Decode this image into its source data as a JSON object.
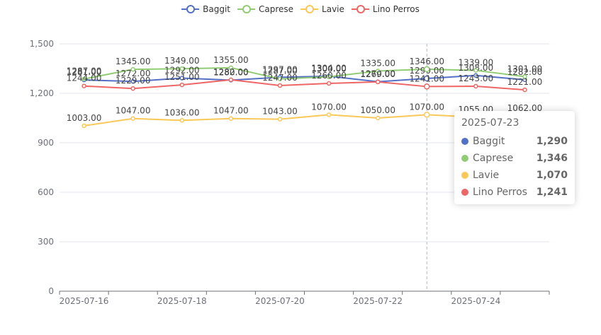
{
  "chart_data": {
    "type": "line",
    "categories": [
      "2025-07-16",
      "2025-07-17",
      "2025-07-18",
      "2025-07-19",
      "2025-07-20",
      "2025-07-21",
      "2025-07-22",
      "2025-07-23",
      "2025-07-24",
      "2025-07-25"
    ],
    "x_tick_labels": [
      "2025-07-16",
      "2025-07-18",
      "2025-07-20",
      "2025-07-22",
      "2025-07-24"
    ],
    "ylim": [
      0,
      1500
    ],
    "y_ticks": [
      0,
      300,
      600,
      900,
      1200,
      1500
    ],
    "y_tick_labels": [
      "0",
      "300",
      "600",
      "900",
      "1,200",
      "1,500"
    ],
    "grid": true,
    "legend_position": "top-center",
    "series": [
      {
        "name": "Baggit",
        "color": "#5470c6",
        "values": [
          1281,
          1272,
          1292,
          1280,
          1297,
          1304,
          1270,
          1290,
          1308,
          1282
        ],
        "labels": [
          "1281.00",
          "1272.00",
          "1292.00",
          "1280.00",
          "1297.00",
          "1304.00",
          "1270.00",
          "1290.00",
          "1308.00",
          "1282.00"
        ]
      },
      {
        "name": "Caprese",
        "color": "#91cc75",
        "values": [
          1287,
          1345,
          1349,
          1355,
          1287,
          1300,
          1335,
          1346,
          1339,
          1301
        ],
        "labels": [
          "1287.00",
          "1345.00",
          "1349.00",
          "1355.00",
          "1287.00",
          "1300.00",
          "1335.00",
          "1346.00",
          "1339.00",
          "1301.00"
        ]
      },
      {
        "name": "Lavie",
        "color": "#fac858",
        "values": [
          1003,
          1047,
          1036,
          1047,
          1043,
          1070,
          1050,
          1070,
          1055,
          1062
        ],
        "labels": [
          "1003.00",
          "1047.00",
          "1036.00",
          "1047.00",
          "1043.00",
          "1070.00",
          "1050.00",
          "1070.00",
          "1055.00",
          "1062.00"
        ]
      },
      {
        "name": "Lino Perros",
        "color": "#ee6666",
        "values": [
          1244,
          1229,
          1251,
          1282,
          1247,
          1260,
          1269,
          1241,
          1243,
          1221
        ],
        "labels": [
          "1244.00",
          "1229.00",
          "1251.00",
          "1282.00",
          "1247.00",
          "1260.00",
          "1269.00",
          "1241.00",
          "1243.00",
          "1221.00"
        ]
      }
    ],
    "tooltip": {
      "category_index": 7,
      "title": "2025-07-23",
      "rows": [
        {
          "name": "Baggit",
          "value": "1,290",
          "color": "#5470c6"
        },
        {
          "name": "Caprese",
          "value": "1,346",
          "color": "#91cc75"
        },
        {
          "name": "Lavie",
          "value": "1,070",
          "color": "#fac858"
        },
        {
          "name": "Lino Perros",
          "value": "1,241",
          "color": "#ee6666"
        }
      ]
    }
  }
}
